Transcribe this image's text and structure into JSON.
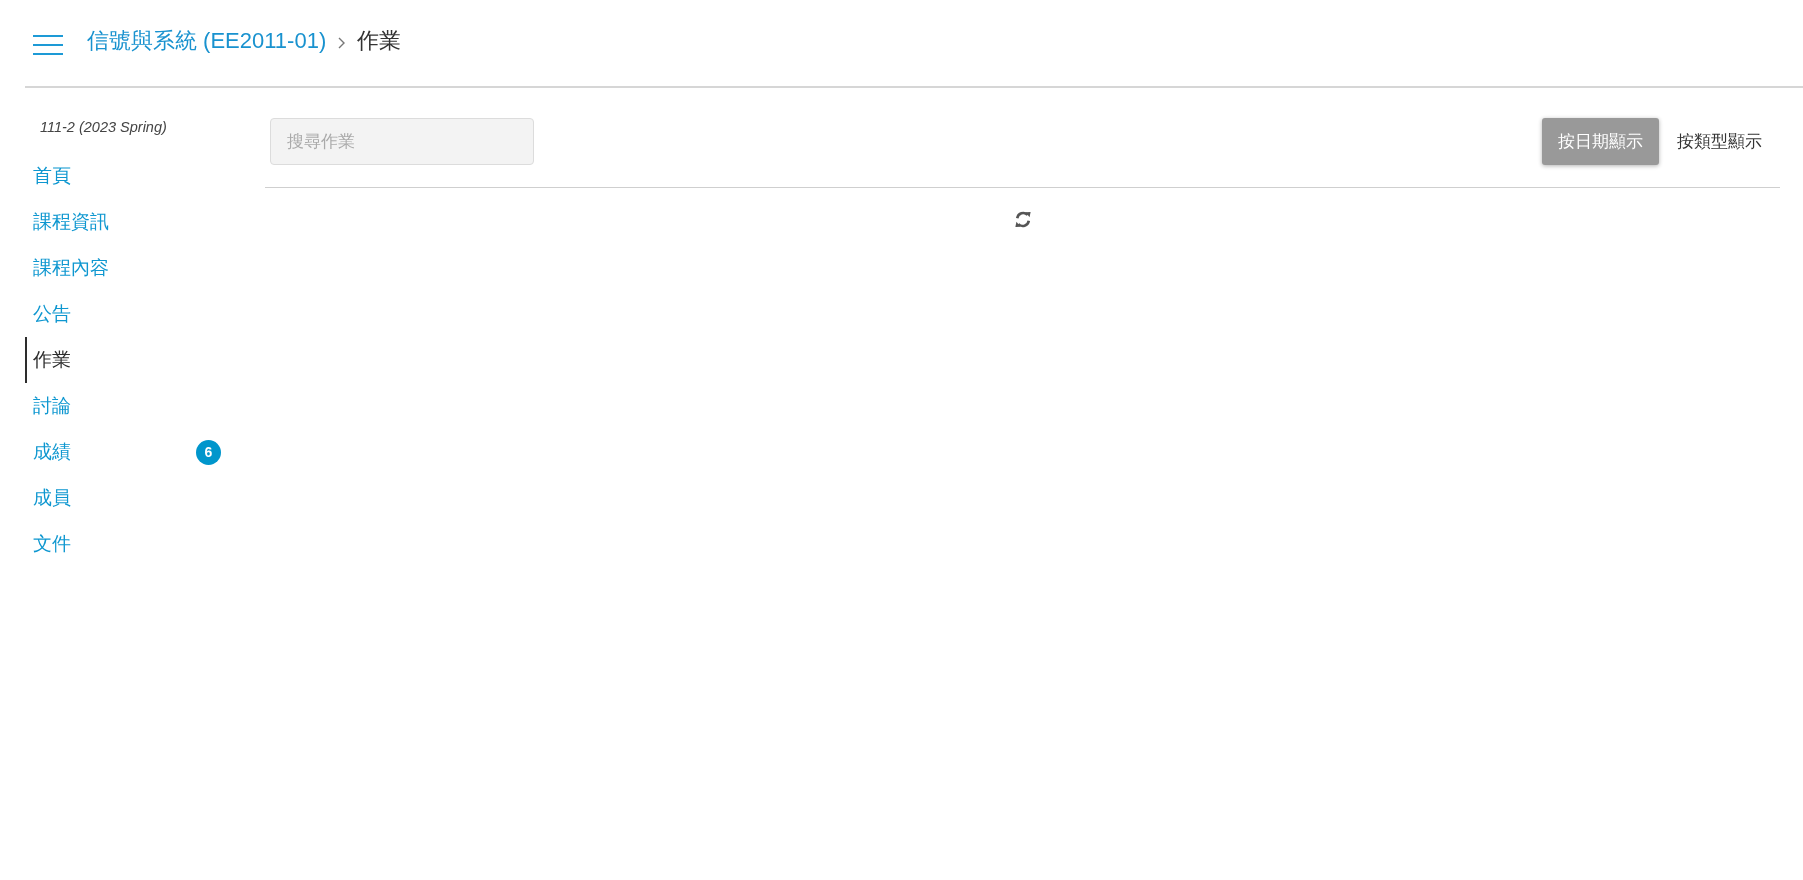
{
  "header": {
    "breadcrumb": [
      {
        "label": "信號與系統 (EE2011-01)",
        "kind": "link"
      },
      {
        "label": "作業",
        "kind": "current"
      }
    ]
  },
  "sidebar": {
    "term": "111-2 (2023 Spring)",
    "items": [
      {
        "label": "首頁",
        "selected": false
      },
      {
        "label": "課程資訊",
        "selected": false
      },
      {
        "label": "課程內容",
        "selected": false
      },
      {
        "label": "公告",
        "selected": false
      },
      {
        "label": "作業",
        "selected": true
      },
      {
        "label": "討論",
        "selected": false
      },
      {
        "label": "成績",
        "selected": false,
        "badge": "6"
      },
      {
        "label": "成員",
        "selected": false
      },
      {
        "label": "文件",
        "selected": false
      }
    ]
  },
  "toolbar": {
    "search": {
      "placeholder": "搜尋作業"
    },
    "view_toggle": [
      {
        "label": "按日期顯示",
        "selected": true
      },
      {
        "label": "按類型顯示",
        "selected": false
      }
    ]
  },
  "content": {
    "loading": true
  }
}
